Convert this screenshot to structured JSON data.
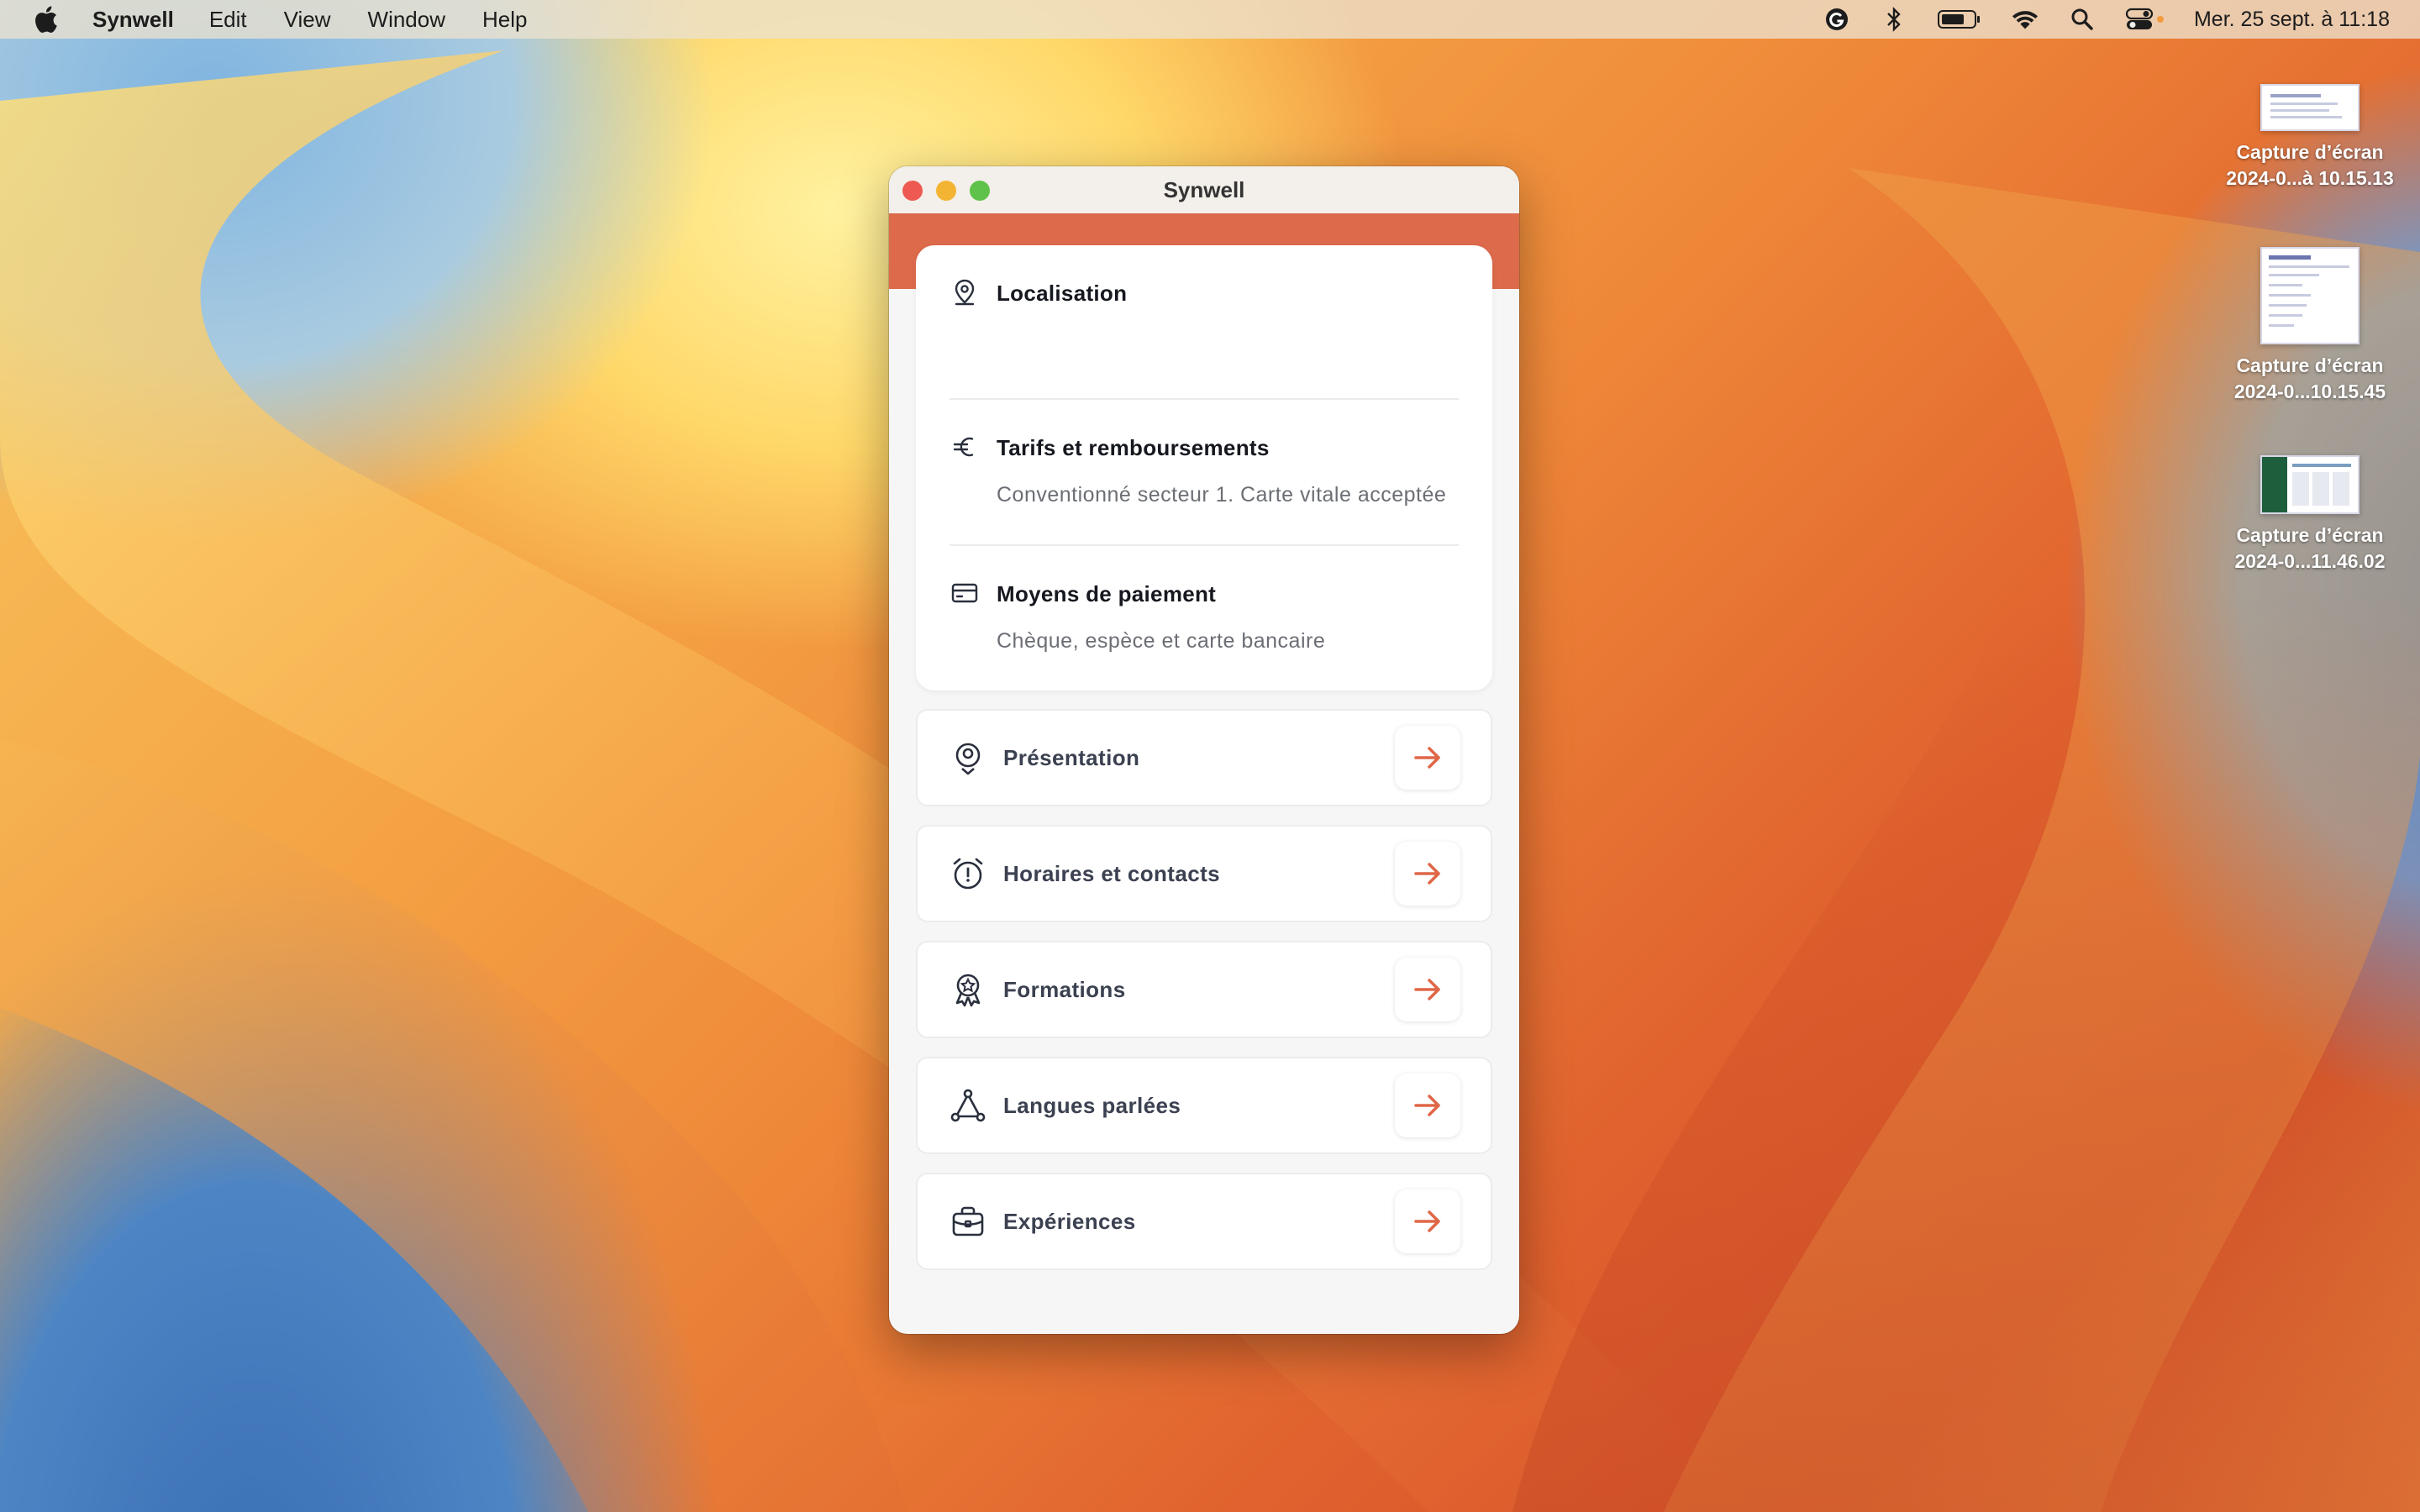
{
  "menubar": {
    "app_name": "Synwell",
    "items": [
      "Edit",
      "View",
      "Window",
      "Help"
    ],
    "clock": "Mer. 25 sept. à 11:18"
  },
  "desktop_icons": [
    {
      "line1": "Capture d’écran",
      "line2": "2024-0...à 10.15.13"
    },
    {
      "line1": "Capture d’écran",
      "line2": "2024-0...10.15.45"
    },
    {
      "line1": "Capture d’écran",
      "line2": "2024-0...11.46.02"
    }
  ],
  "window": {
    "title": "Synwell",
    "accent_color": "#dc6a4b",
    "info": [
      {
        "icon": "location-pin-icon",
        "title": "Localisation",
        "text": ""
      },
      {
        "icon": "euro-icon",
        "title": "Tarifs et remboursements",
        "text": "Conventionné secteur 1. Carte vitale acceptée"
      },
      {
        "icon": "credit-card-icon",
        "title": "Moyens de paiement",
        "text": "Chèque, espèce et carte bancaire"
      }
    ],
    "nav": [
      {
        "icon": "profile-badge-icon",
        "label": "Présentation"
      },
      {
        "icon": "alarm-clock-icon",
        "label": "Horaires et contacts"
      },
      {
        "icon": "award-ribbon-icon",
        "label": "Formations"
      },
      {
        "icon": "triangle-nodes-icon",
        "label": "Langues parlées"
      },
      {
        "icon": "briefcase-icon",
        "label": "Expériences"
      }
    ]
  }
}
